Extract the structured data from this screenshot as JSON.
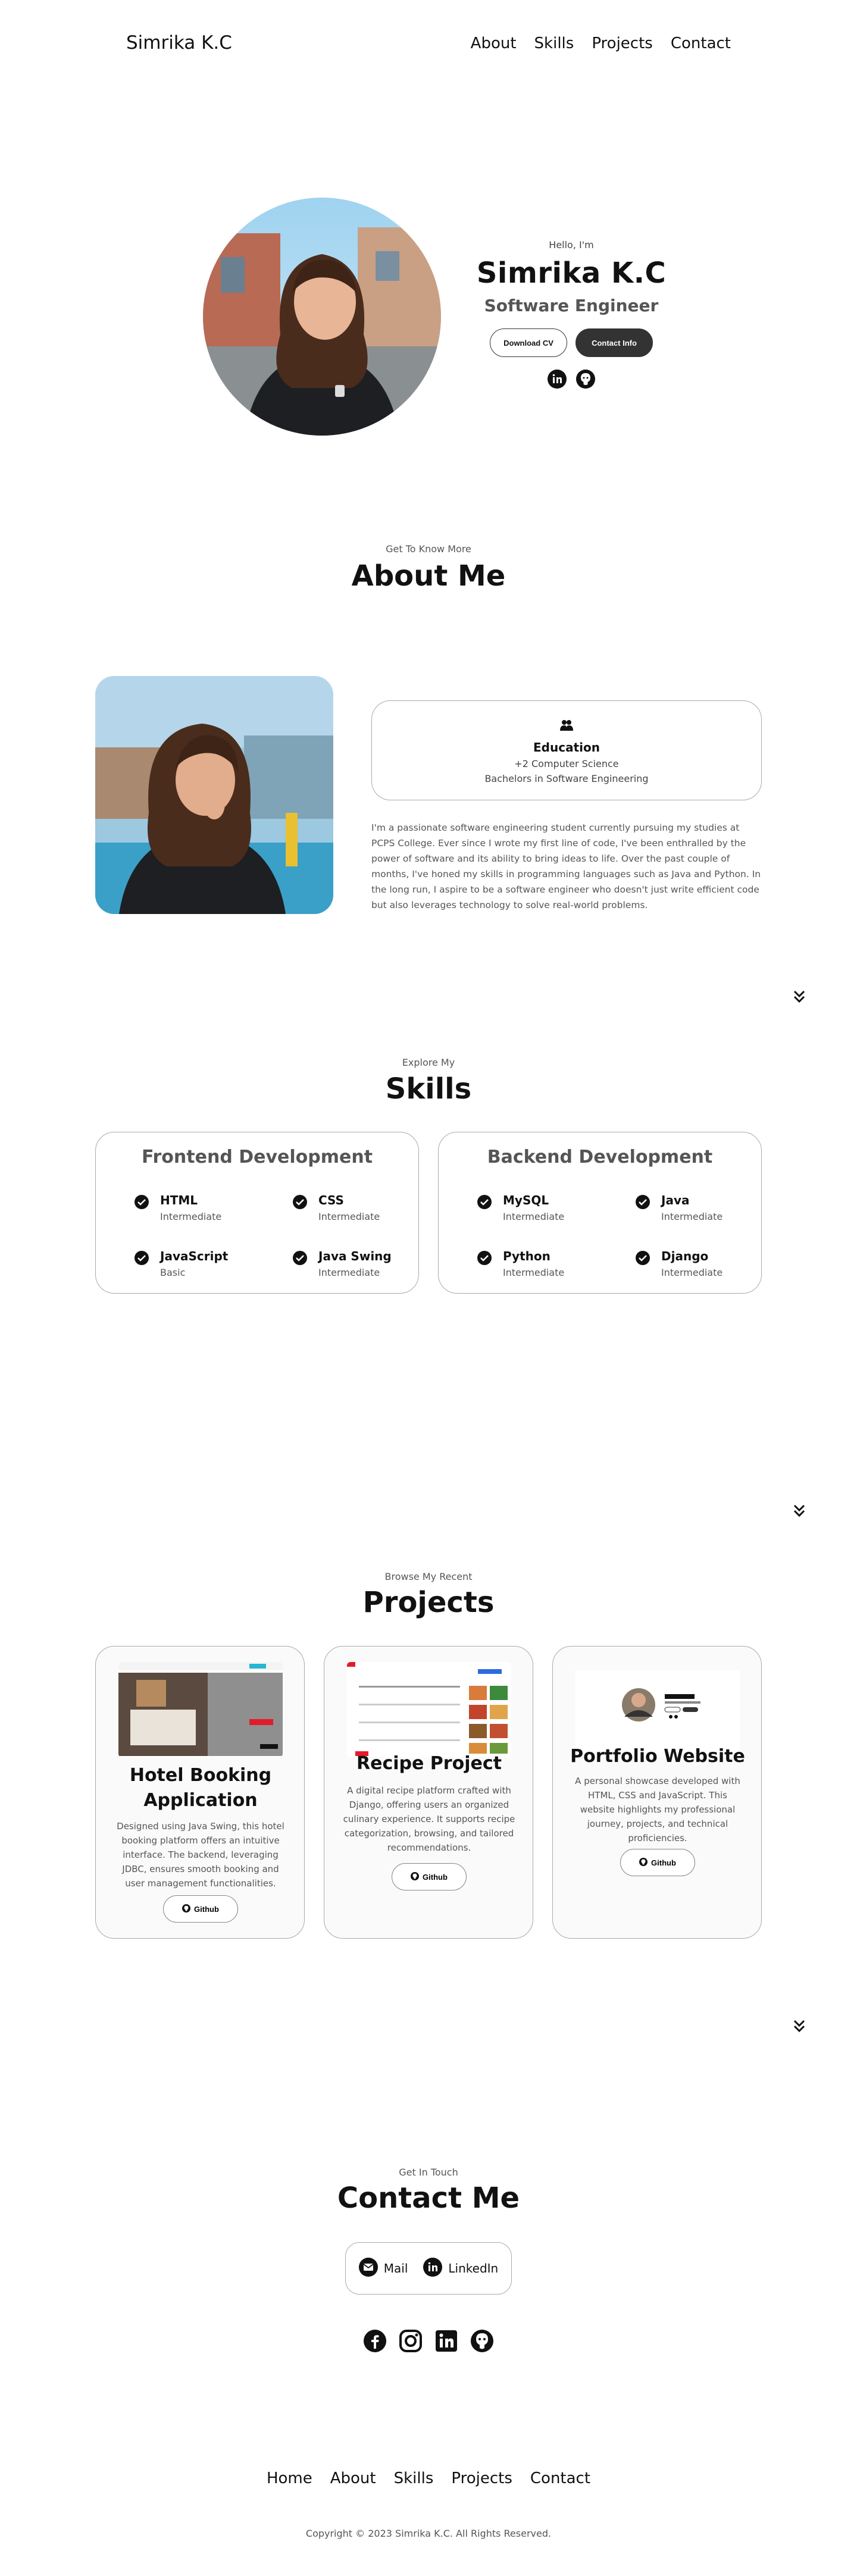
{
  "nav": {
    "logo": "Simrika K.C",
    "links": [
      "About",
      "Skills",
      "Projects",
      "Contact"
    ]
  },
  "hero": {
    "greeting": "Hello, I'm",
    "name": "Simrika K.C",
    "role": "Software Engineer",
    "download_label": "Download CV",
    "contact_label": "Contact Info",
    "social_icons": [
      "linkedin-icon",
      "github-icon"
    ]
  },
  "about": {
    "subtitle": "Get To Know More",
    "title": "About Me",
    "education": {
      "title": "Education",
      "lines": [
        "+2 Computer Science",
        "Bachelors in Software Engineering"
      ]
    },
    "paragraph": "I'm a passionate software engineering student currently pursuing my studies at PCPS College. Ever since I wrote my first line of code, I've been enthralled by the power of software and its ability to bring ideas to life. Over the past couple of months, I've honed my skills in programming languages such as Java and Python. In the long run, I aspire to be a software engineer who doesn't just write efficient code but also leverages technology to solve real-world problems."
  },
  "skills": {
    "subtitle": "Explore My",
    "title": "Skills",
    "frontend": {
      "title": "Frontend Development",
      "items": [
        {
          "name": "HTML",
          "level": "Intermediate"
        },
        {
          "name": "CSS",
          "level": "Intermediate"
        },
        {
          "name": "JavaScript",
          "level": "Basic"
        },
        {
          "name": "Java Swing",
          "level": "Intermediate"
        }
      ]
    },
    "backend": {
      "title": "Backend Development",
      "items": [
        {
          "name": "MySQL",
          "level": "Intermediate"
        },
        {
          "name": "Java",
          "level": "Intermediate"
        },
        {
          "name": "Python",
          "level": "Intermediate"
        },
        {
          "name": "Django",
          "level": "Intermediate"
        }
      ]
    }
  },
  "projects": {
    "subtitle": "Browse My Recent",
    "title": "Projects",
    "items": [
      {
        "title": "Hotel Booking Application",
        "desc": "Designed using Java Swing, this hotel booking platform offers an intuitive interface. The backend, leveraging JDBC, ensures smooth booking and user management functionalities.",
        "button": "Github"
      },
      {
        "title": "Recipe Project",
        "desc": "A digital recipe platform crafted with Django, offering users an organized culinary experience. It supports recipe categorization, browsing, and tailored recommendations.",
        "button": "Github"
      },
      {
        "title": "Portfolio Website",
        "desc": "A personal showcase developed with HTML, CSS and JavaScript. This website highlights my professional journey, projects, and technical proficiencies.",
        "button": "Github"
      }
    ]
  },
  "contact": {
    "subtitle": "Get In Touch",
    "title": "Contact Me",
    "mail_label": "Mail",
    "linkedin_label": "LinkedIn",
    "social_icons": [
      "facebook-icon",
      "instagram-icon",
      "linkedin-icon",
      "github-icon"
    ]
  },
  "footer": {
    "links": [
      "Home",
      "About",
      "Skills",
      "Projects",
      "Contact"
    ],
    "copyright": "Copyright © 2023 Simrika K.C. All Rights Reserved."
  }
}
